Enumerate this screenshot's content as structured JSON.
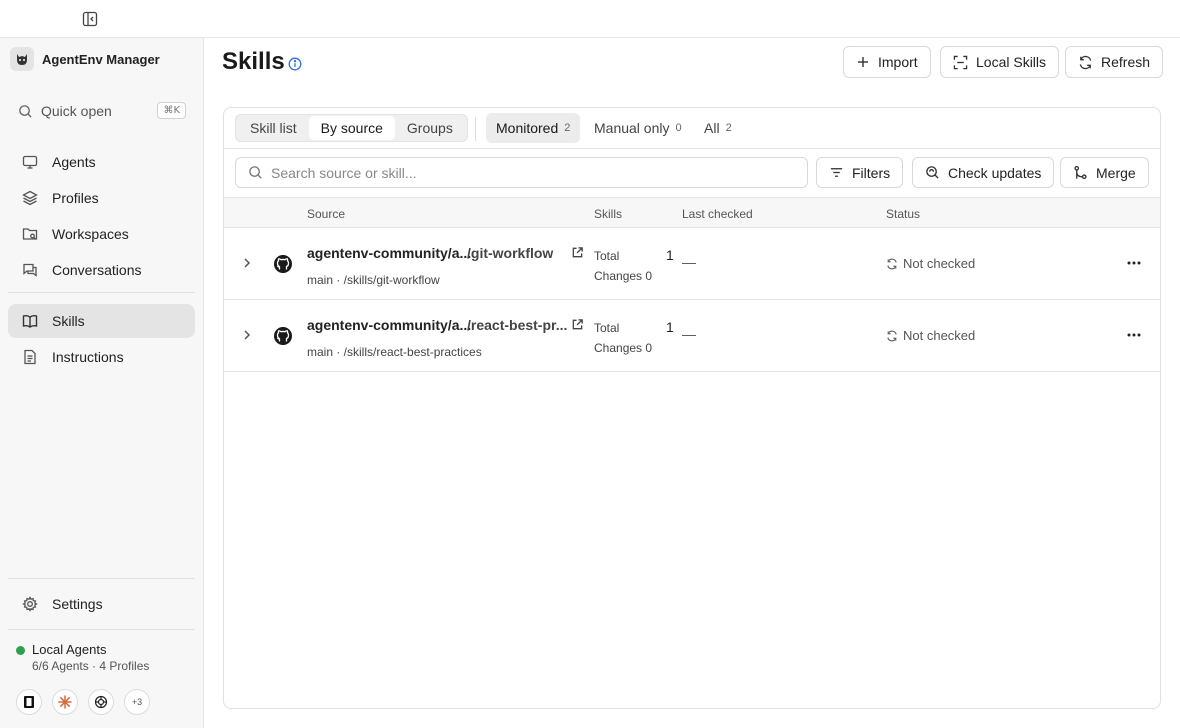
{
  "app": {
    "name": "AgentEnv Manager"
  },
  "sidebar": {
    "quick_open": {
      "label": "Quick open",
      "shortcut": "⌘K"
    },
    "items": [
      {
        "label": "Agents",
        "icon": "monitor-icon"
      },
      {
        "label": "Profiles",
        "icon": "layers-icon"
      },
      {
        "label": "Workspaces",
        "icon": "folder-icon"
      },
      {
        "label": "Conversations",
        "icon": "chat-icon"
      },
      {
        "label": "Skills",
        "icon": "book-icon",
        "active": true
      },
      {
        "label": "Instructions",
        "icon": "document-icon"
      }
    ],
    "settings": {
      "label": "Settings",
      "icon": "gear-icon"
    },
    "status": {
      "title": "Local Agents",
      "subtitle": "6/6 Agents · 4 Profiles",
      "color": "#2e9e4f"
    },
    "agent_icons": {
      "more_label": "+3"
    }
  },
  "header": {
    "title": "Skills",
    "buttons": {
      "import": "Import",
      "local_skills": "Local Skills",
      "refresh": "Refresh"
    }
  },
  "view_tabs": [
    {
      "label": "Skill list",
      "active": false
    },
    {
      "label": "By source",
      "active": true
    },
    {
      "label": "Groups",
      "active": false
    }
  ],
  "filter_tabs": [
    {
      "label": "Monitored",
      "count": "2",
      "active": true
    },
    {
      "label": "Manual only",
      "count": "0",
      "active": false
    },
    {
      "label": "All",
      "count": "2",
      "active": false
    }
  ],
  "search": {
    "placeholder": "Search source or skill..."
  },
  "actions": {
    "filters": "Filters",
    "check_updates": "Check updates",
    "merge": "Merge"
  },
  "table": {
    "columns": {
      "source": "Source",
      "skills": "Skills",
      "last_checked": "Last checked",
      "status": "Status"
    },
    "rows": [
      {
        "source_repo": "agentenv-community/a...",
        "source_path": "/git-workflow",
        "branch": "main · /skills/git-workflow",
        "total_label": "Total",
        "changes_label": "Changes 0",
        "skills_count": "1",
        "last_checked": "—",
        "status": "Not checked"
      },
      {
        "source_repo": "agentenv-community/a...",
        "source_path": "/react-best-pr...",
        "branch": "main · /skills/react-best-practices",
        "total_label": "Total",
        "changes_label": "Changes 0",
        "skills_count": "1",
        "last_checked": "—",
        "status": "Not checked"
      }
    ]
  },
  "colors": {
    "accent_info": "#2f6fd6",
    "status_ok": "#2e9e4f",
    "active_nav": "#e4e4e4"
  }
}
